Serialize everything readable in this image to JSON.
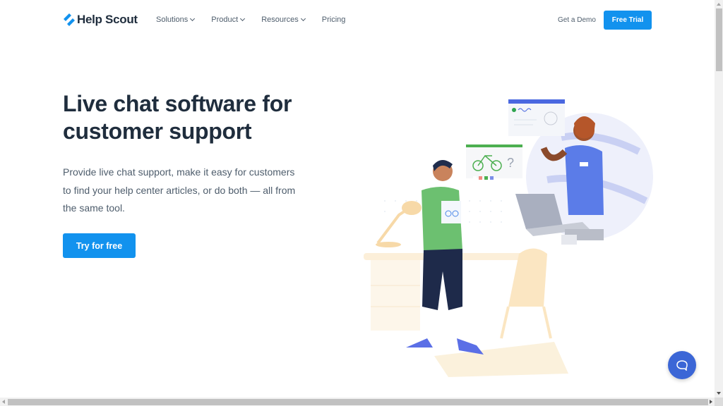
{
  "nav": {
    "logo_text": "Help Scout",
    "menu": [
      {
        "label": "Solutions",
        "has_dropdown": true
      },
      {
        "label": "Product",
        "has_dropdown": true
      },
      {
        "label": "Resources",
        "has_dropdown": true
      },
      {
        "label": "Pricing",
        "has_dropdown": false
      }
    ],
    "demo_label": "Get a Demo",
    "trial_label": "Free Trial"
  },
  "hero": {
    "title": "Live chat software for customer support",
    "description": "Provide live chat support, make it easy for customers to find your help center articles, or do both — all from the same tool.",
    "cta_label": "Try for free"
  },
  "illustration": {
    "icon": "customer-support-chat-illustration"
  },
  "chat_widget": {
    "icon": "chat-bubble-icon"
  },
  "colors": {
    "brand_blue": "#1292ee",
    "widget_blue": "#3b66d6",
    "text_dark": "#1f2d3d",
    "text_muted": "#4e5d6c"
  }
}
